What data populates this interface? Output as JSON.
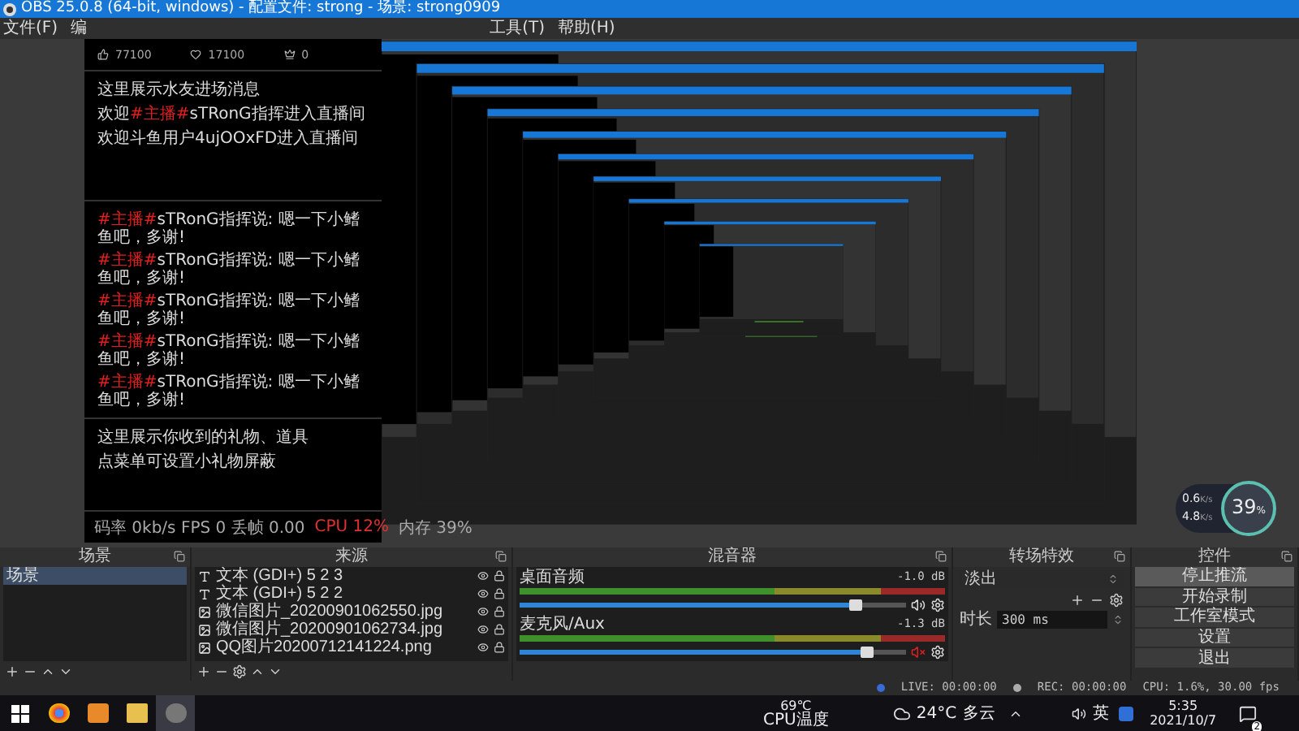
{
  "window": {
    "title": "OBS 25.0.8 (64-bit, windows) - 配置文件: strong - 场景: strong0909"
  },
  "menu": [
    {
      "label": "文件(F)"
    },
    {
      "label": "编"
    },
    {
      "label": "工具(T)"
    },
    {
      "label": "帮助(H)"
    }
  ],
  "chat_window": {
    "stats": [
      {
        "value": "77100"
      },
      {
        "value": "17100"
      },
      {
        "value": "0"
      }
    ],
    "entry_title": "这里展示水友进场消息",
    "entries": [
      {
        "before": "欢迎",
        "tag": "#主播#",
        "after": "sTRonG指挥进入直播间"
      },
      {
        "before": "欢迎斗鱼用户4ujOOxFD进入直播间"
      }
    ],
    "messages": [
      {
        "tag": "#主播#",
        "after": "sTRonG指挥说: 嗯一下小鳍鱼吧，多谢!"
      },
      {
        "tag": "#主播#",
        "after": "sTRonG指挥说: 嗯一下小鳍鱼吧，多谢!"
      },
      {
        "tag": "#主播#",
        "after": "sTRonG指挥说: 嗯一下小鳍鱼吧，多谢!"
      },
      {
        "tag": "#主播#",
        "after": "sTRonG指挥说: 嗯一下小鳍鱼吧，多谢!"
      },
      {
        "tag": "#主播#",
        "after": "sTRonG指挥说: 嗯一下小鳍鱼吧，多谢!"
      }
    ],
    "gifts_title": "这里展示你收到的礼物、道具",
    "gifts_hint": "点菜单可设置小礼物屏蔽",
    "footer_left": "码率 0kb/s FPS 0 丢帧 0.00",
    "footer_cpu": "CPU 12%",
    "footer_mem": "内存 39%"
  },
  "scenes": {
    "title": "场景",
    "items": [
      {
        "label": "场景",
        "selected": true
      }
    ]
  },
  "sources": {
    "title": "来源",
    "items": [
      {
        "kind": "text",
        "label": "文本 (GDI+) 5 2 3"
      },
      {
        "kind": "text",
        "label": "文本 (GDI+) 5 2 2"
      },
      {
        "kind": "image",
        "label": "微信图片_20200901062550.jpg"
      },
      {
        "kind": "image",
        "label": "微信图片_20200901062734.jpg"
      },
      {
        "kind": "image",
        "label": "QQ图片20200712141224.png"
      }
    ]
  },
  "mixer": {
    "title": "混音器",
    "channels": [
      {
        "name": "桌面音频",
        "reading": "-1.0 dB",
        "level": 0.87,
        "muted": false
      },
      {
        "name": "麦克风/Aux",
        "reading": "-1.3 dB",
        "level": 0.9,
        "muted": true
      }
    ]
  },
  "transitions": {
    "title": "转场特效",
    "type": "淡出",
    "duration_label": "时长",
    "duration": "300 ms"
  },
  "controls": {
    "title": "控件",
    "buttons": [
      {
        "label": "停止推流",
        "active": true
      },
      {
        "label": "开始录制",
        "active": false
      },
      {
        "label": "工作室模式",
        "active": false
      },
      {
        "label": "设置",
        "active": false
      },
      {
        "label": "退出",
        "active": false
      }
    ]
  },
  "status_bar": {
    "live": "LIVE: 00:00:00",
    "rec": "REC: 00:00:00",
    "cpu": "CPU: 1.6%, 30.00 fps"
  },
  "gauge": {
    "upload": "0.6",
    "download": "4.8",
    "upload_unit": "K/s",
    "download_unit": "K/s",
    "percent": "39",
    "percent_sign": "%"
  },
  "taskbar": {
    "cpu_temp": "69℃",
    "cpu_label": "CPU温度",
    "weather_temp": "24°C",
    "weather": "多云",
    "ime": "英",
    "time": "5:35",
    "date": "2021/10/7",
    "notifications": "2"
  }
}
